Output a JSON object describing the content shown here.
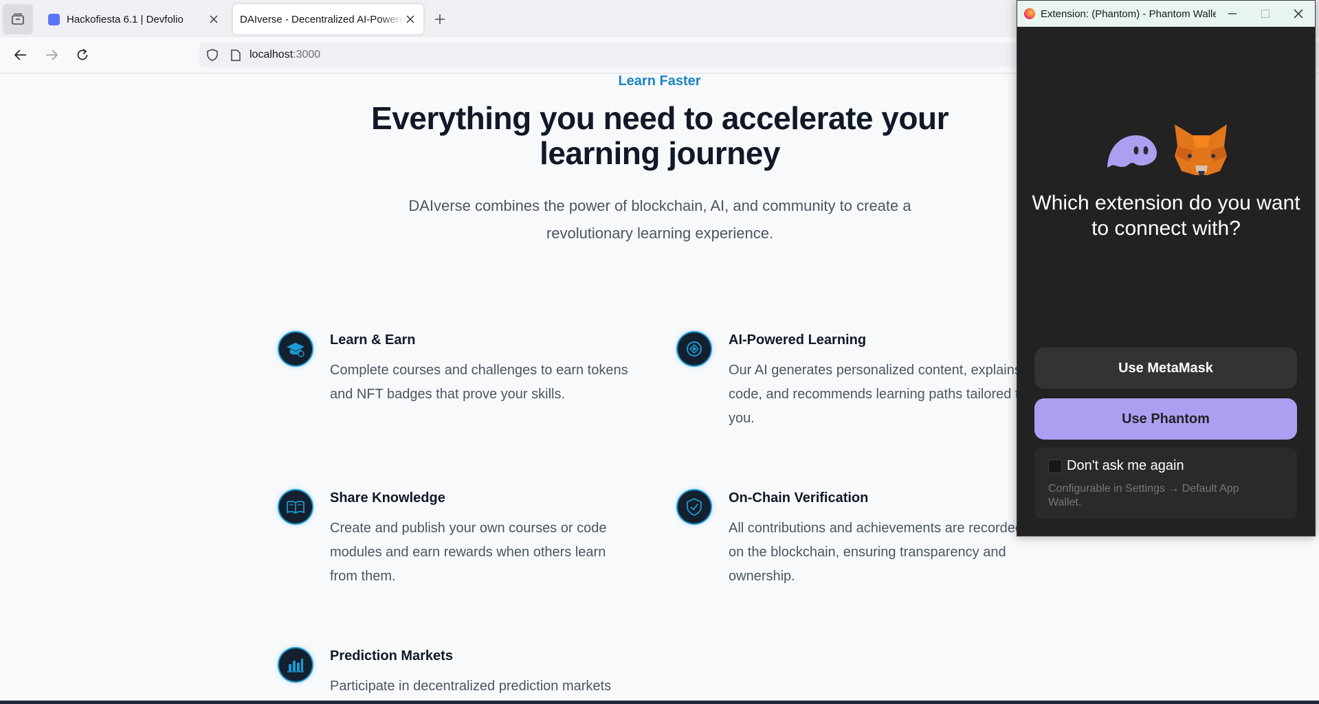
{
  "browser": {
    "tabs": [
      {
        "title": "Hackofiesta 6.1 | Devfolio",
        "active": false
      },
      {
        "title": "DAIverse - Decentralized AI-Powered",
        "active": true
      }
    ],
    "url": {
      "host": "localhost",
      "port": ":3000"
    }
  },
  "page": {
    "eyebrow": "Learn Faster",
    "headline": "Everything you need to accelerate your learning journey",
    "subtext": "DAIverse combines the power of blockchain, AI, and community to create a revolutionary learning experience.",
    "features": [
      {
        "icon": "graduation-cap-icon",
        "title": "Learn & Earn",
        "description": "Complete courses and challenges to earn tokens and NFT badges that prove your skills."
      },
      {
        "icon": "ai-chip-icon",
        "title": "AI-Powered Learning",
        "description": "Our AI generates personalized content, explains code, and recommends learning paths tailored to you."
      },
      {
        "icon": "open-book-icon",
        "title": "Share Knowledge",
        "description": "Create and publish your own courses or code modules and earn rewards when others learn from them."
      },
      {
        "icon": "shield-check-icon",
        "title": "On-Chain Verification",
        "description": "All contributions and achievements are recorded on the blockchain, ensuring transparency and ownership."
      },
      {
        "icon": "bar-chart-icon",
        "title": "Prediction Markets",
        "description": "Participate in decentralized prediction markets"
      }
    ]
  },
  "popup": {
    "window_title": "Extension: (Phantom) - Phantom Wallet",
    "question": "Which extension do you want to connect with?",
    "metamask_button": "Use MetaMask",
    "phantom_button": "Use Phantom",
    "dont_ask_label": "Don't ask me again",
    "dont_ask_checked": false,
    "hint": "Configurable in Settings → Default App Wallet.",
    "colors": {
      "phantom_purple": "#ab9ff2",
      "background": "#222222"
    }
  }
}
